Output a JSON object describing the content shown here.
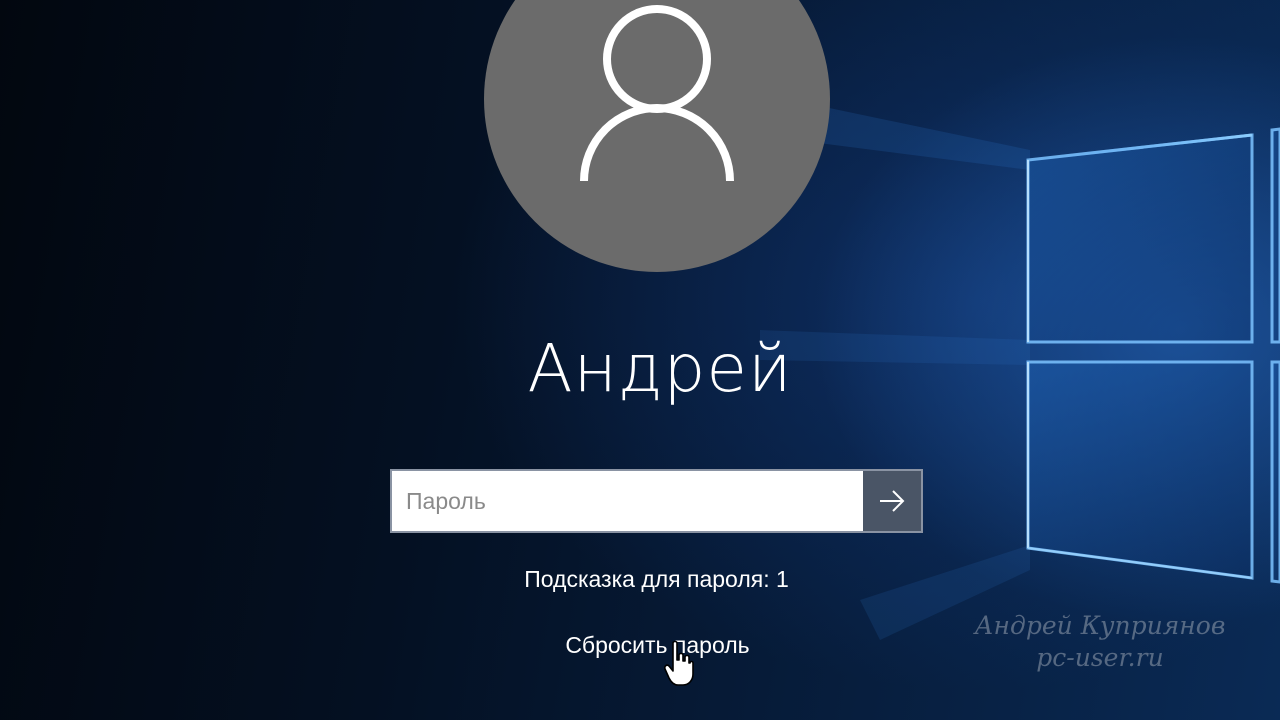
{
  "user": {
    "name": "Андрей"
  },
  "password": {
    "placeholder": "Пароль",
    "value": ""
  },
  "hint": {
    "text": "Подсказка для пароля: 1"
  },
  "reset": {
    "label": "Сбросить пароль"
  },
  "watermark": {
    "line1": "Андрей Куприянов",
    "line2": "pc-user.ru"
  },
  "icons": {
    "avatar": "user-silhouette-icon",
    "submit": "arrow-right-icon",
    "cursor": "hand-pointer-icon"
  },
  "colors": {
    "avatar_bg": "#6b6b6b",
    "submit_bg": "#4a5566",
    "background": "#041022",
    "accent_light": "#2a7bd6"
  }
}
